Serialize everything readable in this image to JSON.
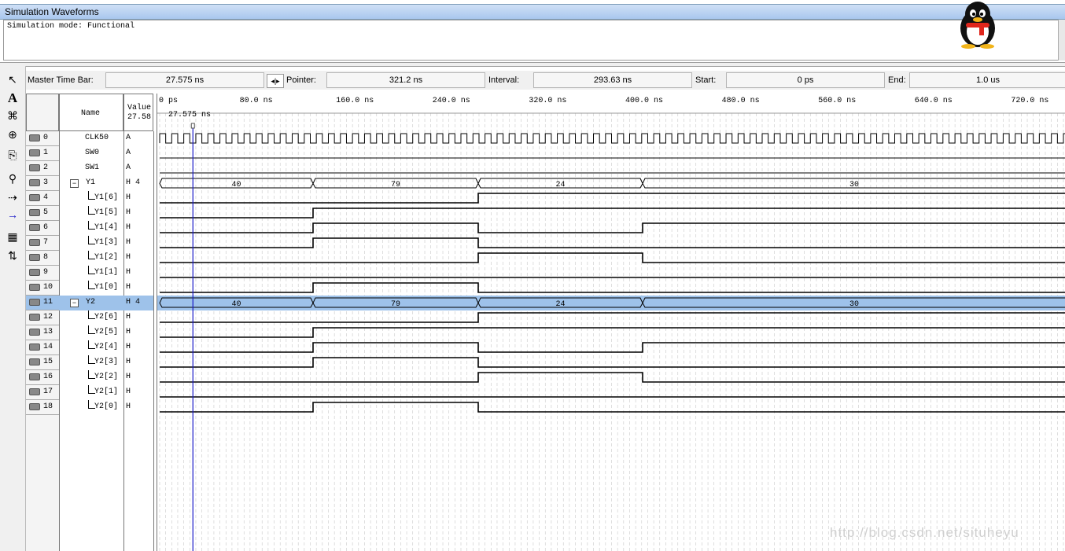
{
  "window": {
    "title": "Simulation Waveforms",
    "mode_text": "Simulation mode: Functional"
  },
  "timebar": {
    "master_label": "Master Time Bar:",
    "master_value": "27.575 ns",
    "pointer_label": "Pointer:",
    "pointer_value": "321.2 ns",
    "interval_label": "Interval:",
    "interval_value": "293.63 ns",
    "start_label": "Start:",
    "start_value": "0 ps",
    "end_label": "End:",
    "end_value": "1.0 us"
  },
  "headers": {
    "name": "Name",
    "value_line1": "Value",
    "value_line2": "27.58"
  },
  "ruler": {
    "ticks": [
      "0 ps",
      "80.0 ns",
      "160.0 ns",
      "240.0 ns",
      "320.0 ns",
      "400.0 ns",
      "480.0 ns",
      "560.0 ns",
      "640.0 ns",
      "720.0 ns"
    ],
    "cursor_label": "27.575 ns"
  },
  "signals": [
    {
      "num": "0",
      "name": "CLK50",
      "value": "A",
      "kind": "clock"
    },
    {
      "num": "1",
      "name": "SW0",
      "value": "A",
      "kind": "low"
    },
    {
      "num": "2",
      "name": "SW1",
      "value": "A",
      "kind": "low"
    },
    {
      "num": "3",
      "name": "Y1",
      "value": "H 4",
      "kind": "bus",
      "group": true
    },
    {
      "num": "4",
      "name": "Y1[6]",
      "value": "H",
      "kind": "bit",
      "levels": [
        0,
        0,
        1,
        1
      ]
    },
    {
      "num": "5",
      "name": "Y1[5]",
      "value": "H",
      "kind": "bit",
      "levels": [
        0,
        1,
        1,
        1
      ]
    },
    {
      "num": "6",
      "name": "Y1[4]",
      "value": "H",
      "kind": "bit",
      "levels": [
        0,
        1,
        0,
        1
      ]
    },
    {
      "num": "7",
      "name": "Y1[3]",
      "value": "H",
      "kind": "bit",
      "levels": [
        0,
        1,
        0,
        0
      ]
    },
    {
      "num": "8",
      "name": "Y1[2]",
      "value": "H",
      "kind": "bit",
      "levels": [
        0,
        0,
        1,
        0
      ]
    },
    {
      "num": "9",
      "name": "Y1[1]",
      "value": "H",
      "kind": "bit",
      "levels": [
        0,
        0,
        0,
        0
      ]
    },
    {
      "num": "10",
      "name": "Y1[0]",
      "value": "H",
      "kind": "bit",
      "levels": [
        0,
        1,
        0,
        0
      ]
    },
    {
      "num": "11",
      "name": "Y2",
      "value": "H 4",
      "kind": "bus",
      "group": true,
      "selected": true
    },
    {
      "num": "12",
      "name": "Y2[6]",
      "value": "H",
      "kind": "bit",
      "levels": [
        0,
        0,
        1,
        1
      ]
    },
    {
      "num": "13",
      "name": "Y2[5]",
      "value": "H",
      "kind": "bit",
      "levels": [
        0,
        1,
        1,
        1
      ]
    },
    {
      "num": "14",
      "name": "Y2[4]",
      "value": "H",
      "kind": "bit",
      "levels": [
        0,
        1,
        0,
        1
      ]
    },
    {
      "num": "15",
      "name": "Y2[3]",
      "value": "H",
      "kind": "bit",
      "levels": [
        0,
        1,
        0,
        0
      ]
    },
    {
      "num": "16",
      "name": "Y2[2]",
      "value": "H",
      "kind": "bit",
      "levels": [
        0,
        0,
        1,
        0
      ]
    },
    {
      "num": "17",
      "name": "Y2[1]",
      "value": "H",
      "kind": "bit",
      "levels": [
        0,
        0,
        0,
        0
      ]
    },
    {
      "num": "18",
      "name": "Y2[0]",
      "value": "H",
      "kind": "bit",
      "levels": [
        0,
        1,
        0,
        0
      ]
    }
  ],
  "bus_values": [
    "40",
    "79",
    "24",
    "30"
  ],
  "colors": {
    "selected_row": "#9ec2ea",
    "cursor": "#1a1ac8",
    "titlebar": "#a9c7ee"
  },
  "watermark": "http://blog.csdn.net/situheyu"
}
